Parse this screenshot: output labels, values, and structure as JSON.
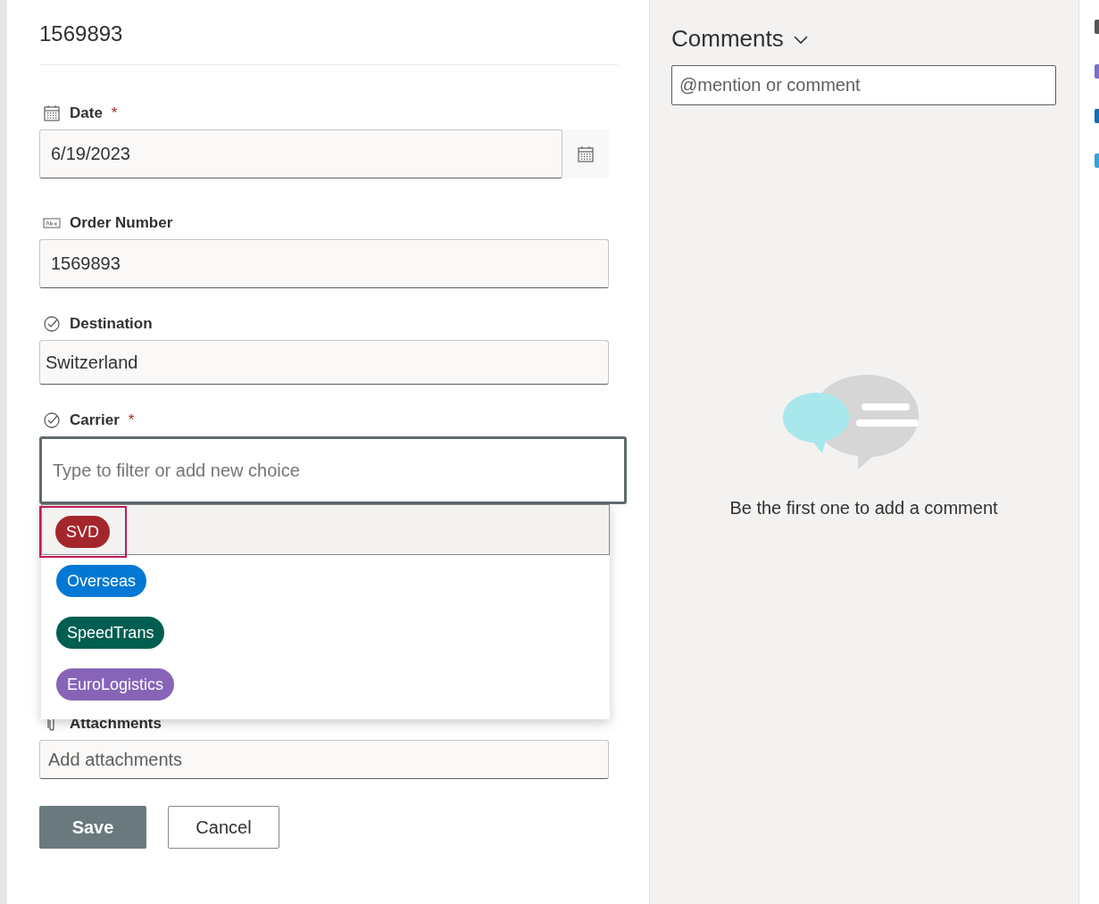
{
  "record": {
    "title": "1569893"
  },
  "fields": [
    {
      "kind": "date",
      "label": "Date",
      "required_mark": "*",
      "value": "6/19/2023"
    },
    {
      "kind": "text",
      "label": "Order Number",
      "value": "1569893"
    },
    {
      "kind": "choice",
      "label": "Destination",
      "value": "Switzerland"
    },
    {
      "kind": "combo",
      "label": "Carrier",
      "required_mark": "*",
      "placeholder": "Type to filter or add new choice",
      "options": [
        {
          "label": "SVD",
          "color": "#a4262c",
          "selected": true
        },
        {
          "label": "Overseas",
          "color": "#0078d4",
          "selected": false
        },
        {
          "label": "SpeedTrans",
          "color": "#005e50",
          "selected": false
        },
        {
          "label": "EuroLogistics",
          "color": "#8764b8",
          "selected": false
        }
      ]
    },
    {
      "kind": "attachment",
      "label": "Attachments",
      "placeholder": "Add attachments"
    }
  ],
  "buttons": [
    {
      "label": "Save",
      "kind": "primary"
    },
    {
      "label": "Cancel",
      "kind": "secondary"
    }
  ],
  "comments": {
    "title": "Comments",
    "placeholder": "@mention or comment",
    "empty_message": "Be the first one to add a comment"
  }
}
